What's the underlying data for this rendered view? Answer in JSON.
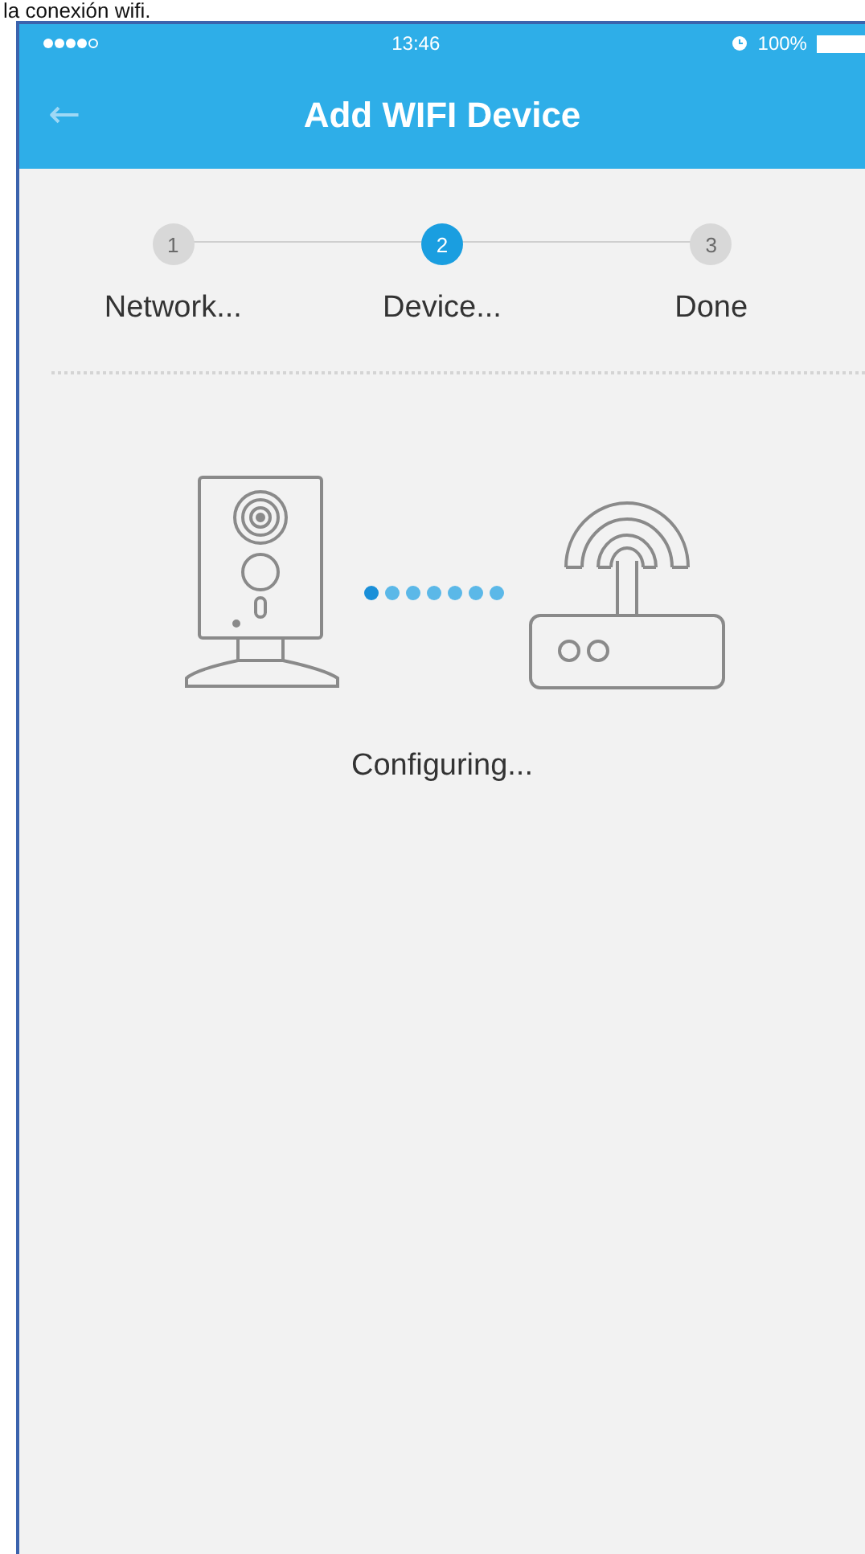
{
  "caption": "la conexión wifi.",
  "status_bar": {
    "time": "13:46",
    "battery": "100%"
  },
  "nav_bar": {
    "back": "←",
    "title": "Add WIFI Device"
  },
  "steps": [
    {
      "number": "1",
      "label": "Network...",
      "selected": false
    },
    {
      "number": "2",
      "label": "Device...",
      "selected": true
    },
    {
      "number": "3",
      "label": "Done",
      "selected": false
    }
  ],
  "status_text": "Configuring..."
}
